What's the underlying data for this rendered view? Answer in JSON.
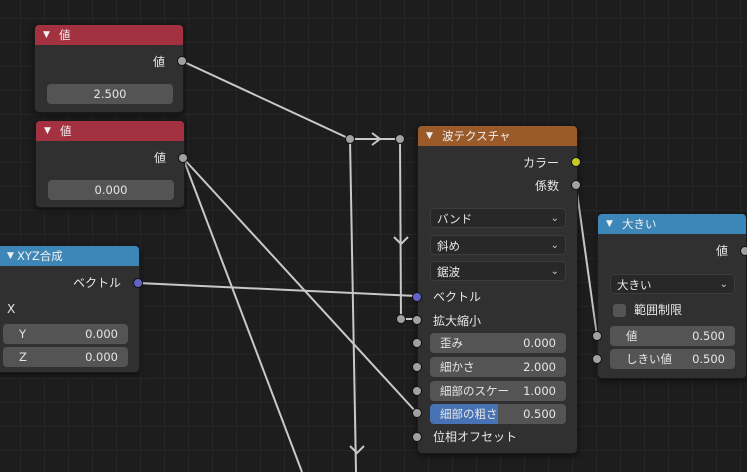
{
  "colors": {
    "input_header": "#a33140",
    "texture_header": "#9a5a2a",
    "converter_header": "#3d86b8",
    "socket_float": "#a1a1a1",
    "socket_vector": "#6363c7",
    "socket_color": "#c7c729",
    "active_field": "#4772b3"
  },
  "value1": {
    "title": "値",
    "output": "値",
    "value": "2.500"
  },
  "value2": {
    "title": "値",
    "output": "値",
    "value": "0.000"
  },
  "combine": {
    "title": "XYZ合成",
    "output": "ベクトル",
    "x_label": "X",
    "y_label": "Y",
    "y_value": "0.000",
    "z_label": "Z",
    "z_value": "0.000"
  },
  "wave": {
    "title": "波テクスチャ",
    "out_color": "カラー",
    "out_fac": "係数",
    "type": "バンド",
    "direction": "斜め",
    "profile": "鋸波",
    "in_vector": "ベクトル",
    "in_scale": "拡大縮小",
    "distortion_label": "歪み",
    "distortion_value": "0.000",
    "detail_label": "細かさ",
    "detail_value": "2.000",
    "detail_scale_label": "細部のスケー",
    "detail_scale_value": "1.000",
    "roughness_label": "細部の粗さ",
    "roughness_value": "0.500",
    "roughness_fill": 0.5,
    "phase_label": "位相オフセット"
  },
  "math": {
    "title": "大きい",
    "output": "値",
    "operation": "大きい",
    "clamp_label": "範囲制限",
    "value_label": "値",
    "value_value": "0.500",
    "threshold_label": "しきい値",
    "threshold_value": "0.500"
  }
}
